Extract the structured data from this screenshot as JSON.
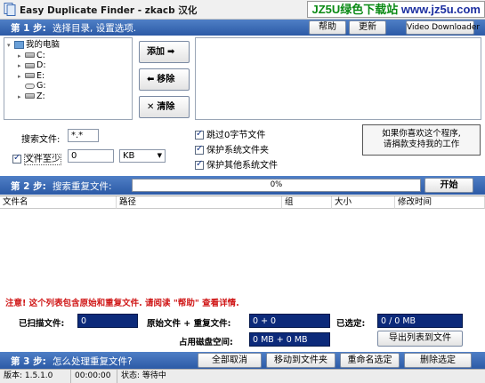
{
  "window": {
    "title": "Easy Duplicate Finder - zkacb 汉化"
  },
  "watermark": {
    "part1": "JZ5U绿色下载站",
    "part2": "www.jz5u.com"
  },
  "step1": {
    "label": "第 1 步:",
    "text": "选择目录, 设置选项.",
    "help_button": "帮助",
    "update_button": "更新",
    "video_button": "Video Downloader"
  },
  "tree": {
    "root": "我的电脑",
    "drives": [
      {
        "label": "C:"
      },
      {
        "label": "D:"
      },
      {
        "label": "E:"
      },
      {
        "label": "G:"
      },
      {
        "label": "Z:"
      }
    ]
  },
  "actions": {
    "add": "添加",
    "remove": "移除",
    "clear": "清除"
  },
  "options": {
    "search_files_label": "搜索文件:",
    "search_files_value": "*.*",
    "min_size_label": "文件至少",
    "min_size_value": "0",
    "size_unit": "KB",
    "skip_zero_label": "跳过0字节文件",
    "skip_zero_checked": true,
    "protect_system_folders_label": "保护系统文件夹",
    "protect_system_folders_checked": true,
    "protect_other_system_label": "保护其他系统文件",
    "protect_other_system_checked": true,
    "min_size_checked": true
  },
  "support": {
    "line1": "如果你喜欢这个程序,",
    "line2": "请捐款支持我的工作"
  },
  "step2": {
    "label": "第 2 步:",
    "text": "搜索重复文件:",
    "progress_text": "0%",
    "progress_value": 0,
    "start_button": "开始"
  },
  "table": {
    "columns": [
      "文件名",
      "路径",
      "组",
      "大小",
      "修改时间"
    ],
    "rows": []
  },
  "notice": "注意! 这个列表包含原始和重复文件. 请阅读 \"帮助\" 查看详情.",
  "stats": {
    "scanned_label": "已扫描文件:",
    "scanned_value": "0",
    "orig_dup_label": "原始文件 + 重复文件:",
    "orig_dup_value": "0 + 0",
    "selected_label": "已选定:",
    "selected_value": "0 / 0 MB",
    "disk_space_label": "占用磁盘空间:",
    "disk_space_value": "0 MB + 0 MB",
    "export_button": "导出列表到文件"
  },
  "step3": {
    "label": "第 3 步:",
    "text": "怎么处理重复文件?",
    "cancel_all_button": "全部取消",
    "move_button": "移动到文件夹",
    "rename_button": "重命名选定",
    "delete_button": "删除选定"
  },
  "status": {
    "version": "版本: 1.5.1.0",
    "time": "00:00:00",
    "state": "状态: 等待中"
  },
  "colors": {
    "step_bar": "#3a6ab4",
    "dark_field": "#0c2a7a",
    "notice": "#d01818"
  }
}
